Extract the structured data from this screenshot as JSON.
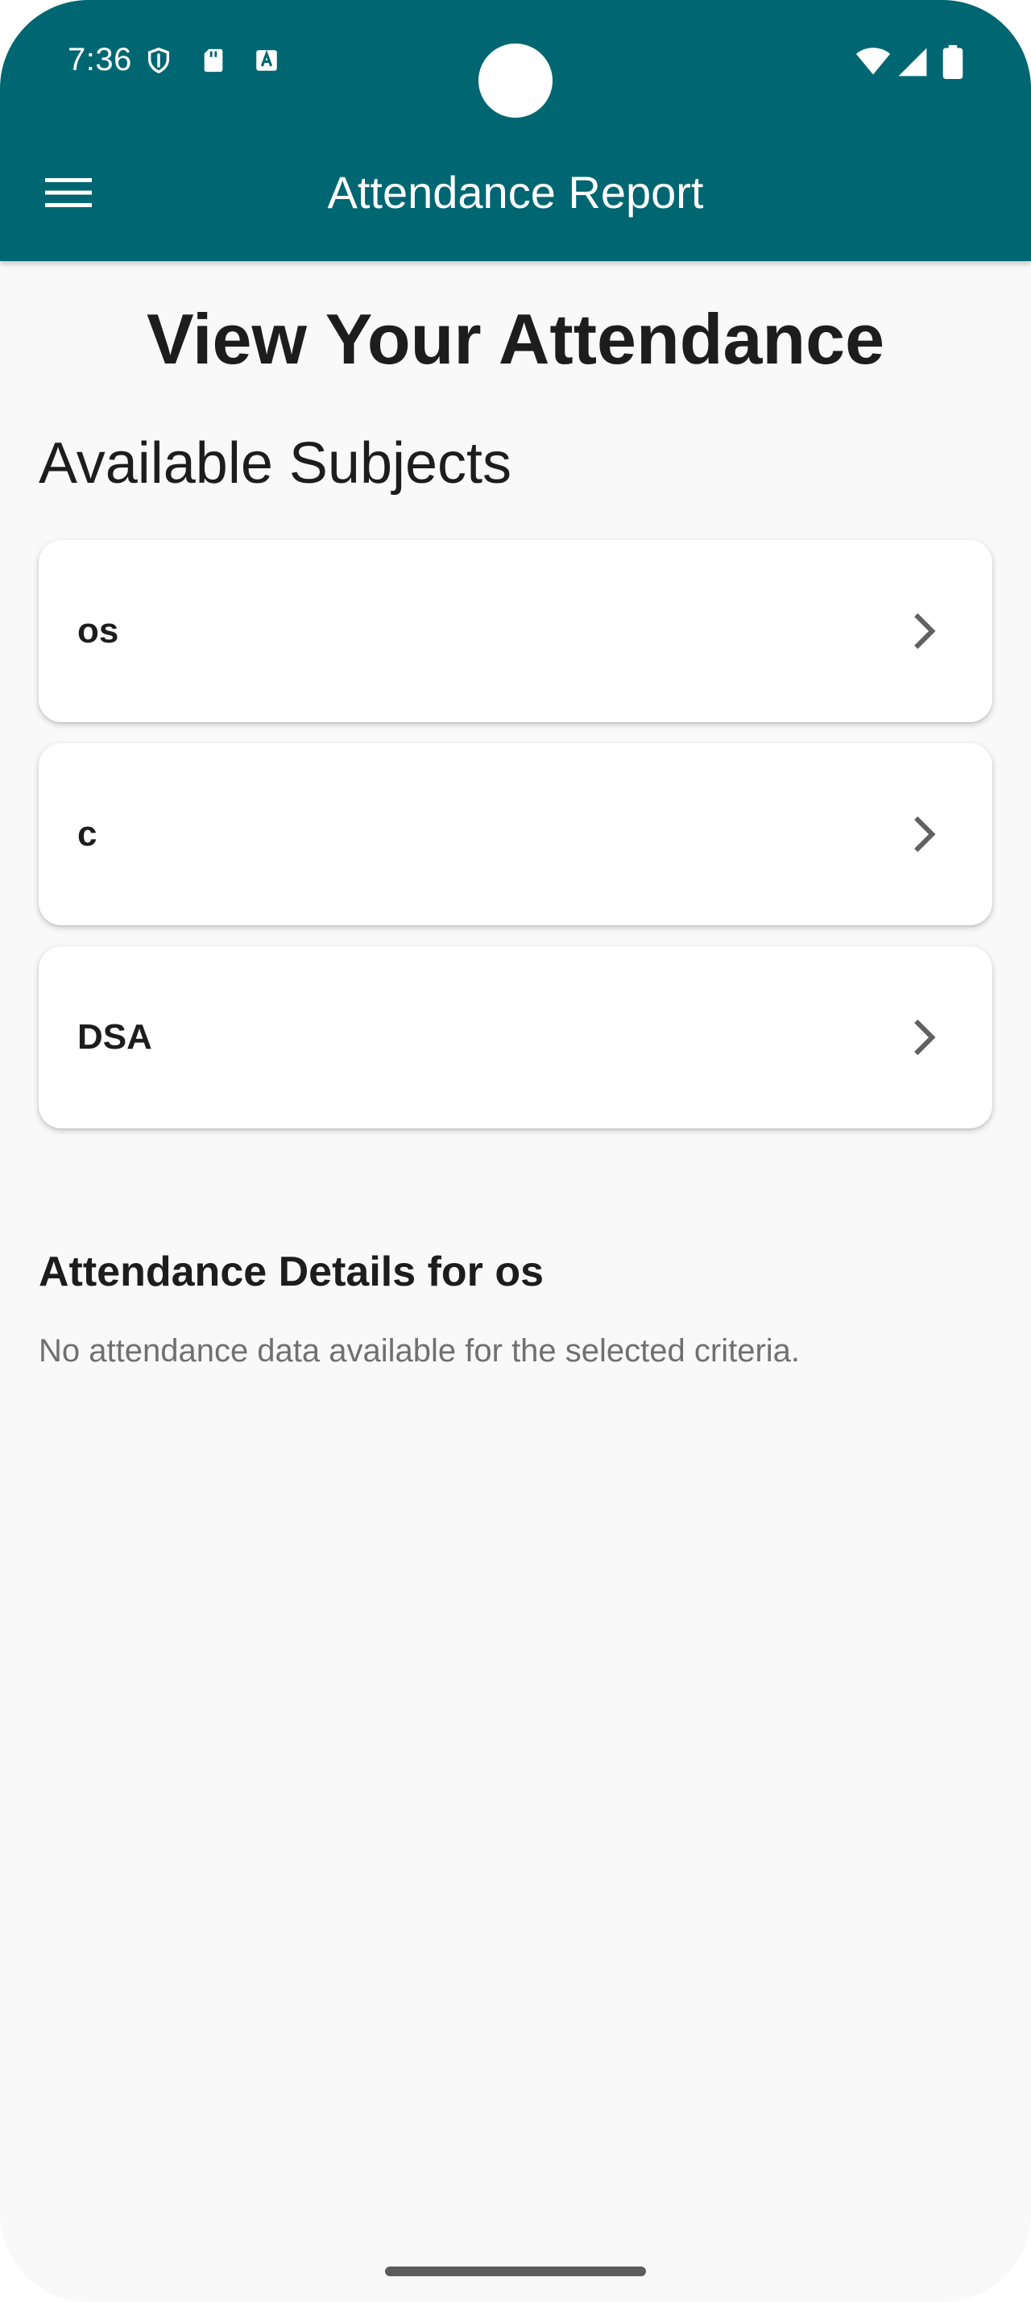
{
  "status_bar": {
    "time": "7:36",
    "left_icons": [
      "shield-icon",
      "sd-card-icon",
      "font-download-icon"
    ],
    "right_icons": [
      "wifi-icon",
      "signal-icon",
      "battery-icon"
    ]
  },
  "app_bar": {
    "title": "Attendance Report",
    "menu_icon": "hamburger-menu-icon",
    "background_color": "#006672"
  },
  "page": {
    "heading": "View Your Attendance",
    "subjects_heading": "Available Subjects",
    "subjects": [
      {
        "label": "os"
      },
      {
        "label": "c"
      },
      {
        "label": "DSA"
      }
    ],
    "details_heading": "Attendance Details for os",
    "details_empty_message": "No attendance data available for the selected criteria."
  }
}
